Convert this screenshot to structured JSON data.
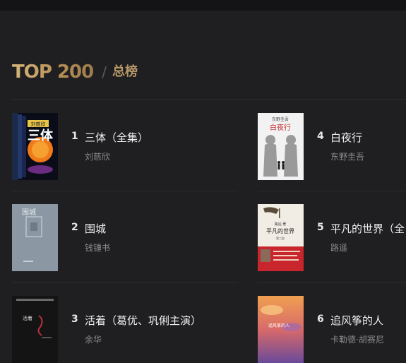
{
  "header": {
    "logo_text": "TOP 200",
    "separator": "/",
    "list_name": "总榜"
  },
  "books": [
    {
      "rank": "1",
      "title": "三体（全集）",
      "author": "刘慈欣"
    },
    {
      "rank": "4",
      "title": "白夜行",
      "author": "东野圭吾"
    },
    {
      "rank": "2",
      "title": "围城",
      "author": "钱锺书"
    },
    {
      "rank": "5",
      "title": "平凡的世界（全",
      "author": "路遥"
    },
    {
      "rank": "3",
      "title": "活着（葛优、巩俐主演）",
      "author": "余华"
    },
    {
      "rank": "6",
      "title": "追风筝的人",
      "author": "卡勒德·胡赛尼"
    }
  ],
  "covers": {
    "santi": {
      "badge": "刘慈欣",
      "big": "三体"
    },
    "baiyexing": {
      "author": "东野圭吾",
      "title": "白夜行"
    },
    "weicheng": {
      "title": "围城"
    },
    "pingfan": {
      "author": "路遥 著",
      "title": "平凡的世界",
      "sub": "第二部"
    },
    "huozhe": {
      "title": "活着"
    },
    "zhuifengzheng": {
      "title": "追风筝的人"
    }
  },
  "colors": {
    "background": "#1f1f21",
    "accent_gold": "#c8a46a",
    "text_primary": "#f0f0f0",
    "text_secondary": "#8a8a8d"
  }
}
